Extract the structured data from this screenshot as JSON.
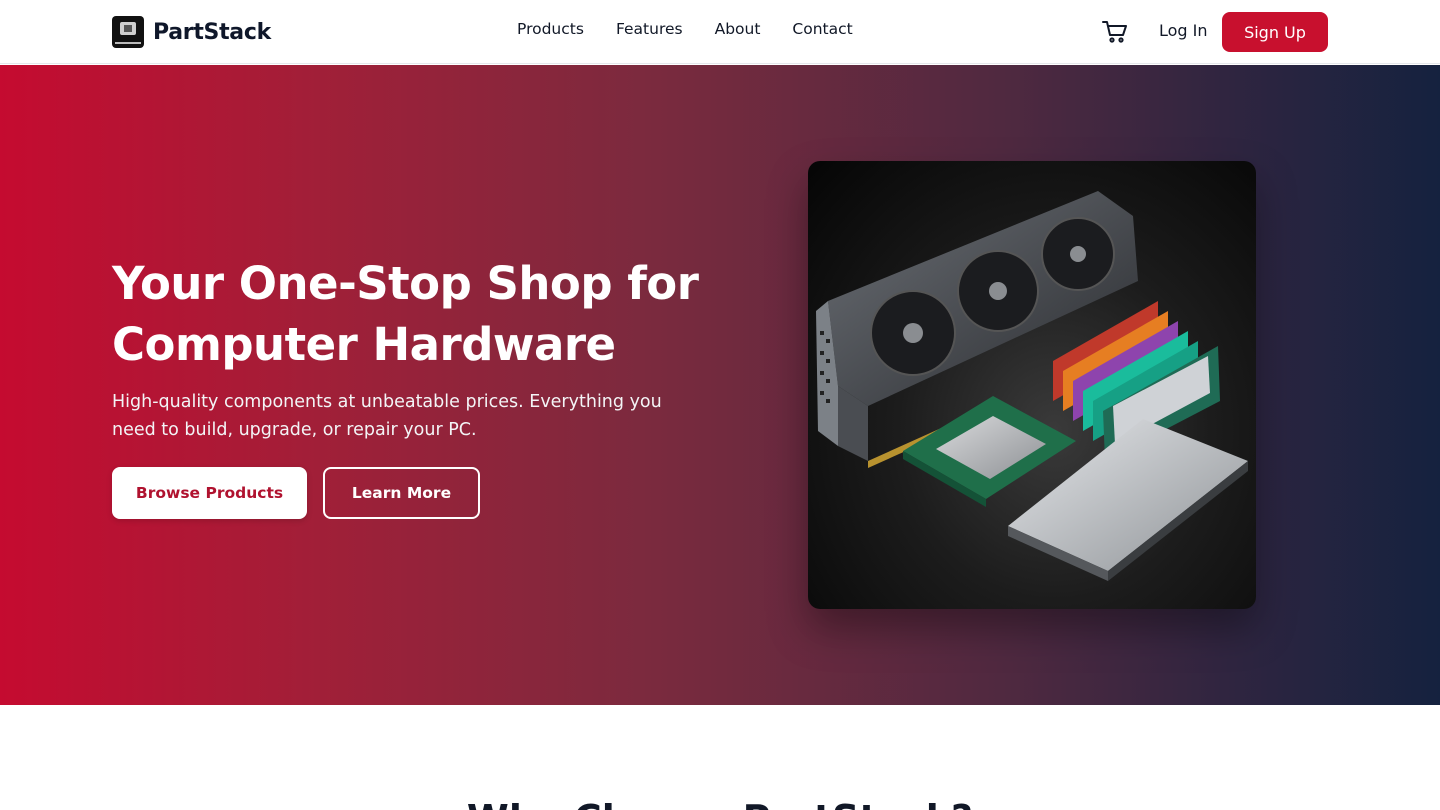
{
  "brand": {
    "name": "PartStack",
    "logo_icon": "chip-logo-icon"
  },
  "nav": {
    "items": [
      "Products",
      "Features",
      "About",
      "Contact"
    ]
  },
  "header_actions": {
    "cart_icon": "cart-icon",
    "login_label": "Log In",
    "signup_label": "Sign Up"
  },
  "hero": {
    "title_line1": "Your One-Stop Shop for",
    "title_line2": "Computer Hardware",
    "subtitle": "High-quality components at unbeatable prices. Everything you need to build, upgrade, or repair your PC.",
    "primary_cta": "Browse Products",
    "secondary_cta": "Learn More",
    "image_alt": "Graphics card, RAM modules, CPU and SSD"
  },
  "section2": {
    "title": "Why Choose PartStack?"
  },
  "colors": {
    "accent": "#c8102e",
    "gradient_start": "#c50b30",
    "gradient_end": "#15223f"
  }
}
